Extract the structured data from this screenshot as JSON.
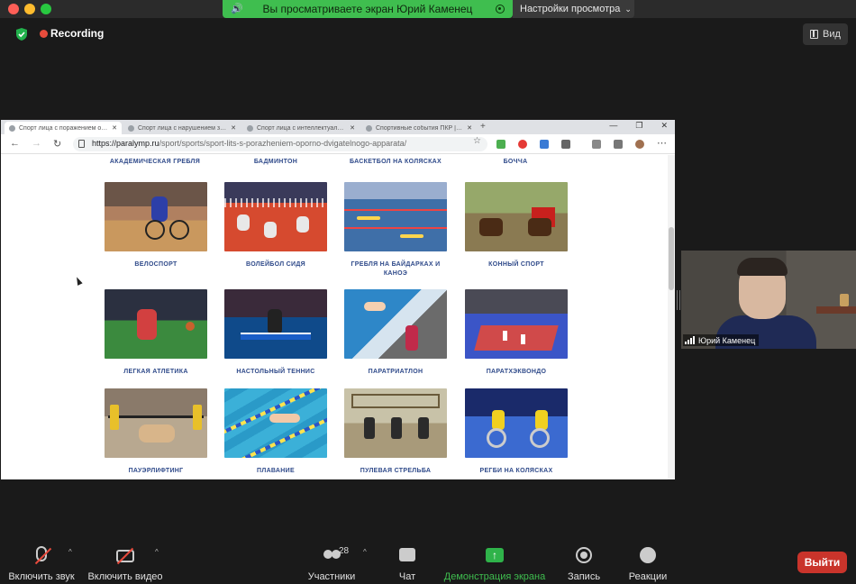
{
  "title_bar": {
    "share_banner": "Вы просматриваете экран Юрий Каменец",
    "view_settings": "Настройки просмотра"
  },
  "recording": {
    "label": "Recording"
  },
  "view_button": {
    "label": "Вид"
  },
  "browser": {
    "tabs": [
      {
        "label": "Спорт лица с поражением опорно-"
      },
      {
        "label": "Спорт лица с нарушением зрения"
      },
      {
        "label": "Спорт лица с интеллектуальными"
      },
      {
        "label": "Спортивные события ПКР | Па"
      }
    ],
    "new_tab": "+",
    "url_host": "https://paralymp.ru",
    "url_path": "/sport/sports/sport-lits-s-porazheniem-oporno-dvigatelnogo-apparata/",
    "top_labels": [
      "АКАДЕМИЧЕСКАЯ ГРЕБЛЯ",
      "БАДМИНТОН",
      "БАСКЕТБОЛ НА КОЛЯСКАХ",
      "БОЧЧА"
    ],
    "sports": [
      {
        "name": "ВЕЛОСПОРТ"
      },
      {
        "name": "ВОЛЕЙБОЛ СИДЯ"
      },
      {
        "name": "ГРЕБЛЯ НА БАЙДАРКАХ И КАНОЭ"
      },
      {
        "name": "КОННЫЙ СПОРТ"
      },
      {
        "name": "ЛЕГКАЯ АТЛЕТИКА"
      },
      {
        "name": "НАСТОЛЬНЫЙ ТЕННИС"
      },
      {
        "name": "ПАРАТРИАТЛОН"
      },
      {
        "name": "ПАРАТХЭКВОНДО"
      },
      {
        "name": "ПАУЭРЛИФТИНГ"
      },
      {
        "name": "ПЛАВАНИЕ"
      },
      {
        "name": "ПУЛЕВАЯ СТРЕЛЬБА"
      },
      {
        "name": "РЕГБИ НА КОЛЯСКАХ"
      }
    ]
  },
  "participant": {
    "name": "Юрий Каменец"
  },
  "toolbar": {
    "unmute": "Включить звук",
    "start_video": "Включить видео",
    "participants": "Участники",
    "participants_count": "28",
    "chat": "Чат",
    "share": "Демонстрация экрана",
    "record": "Запись",
    "reactions": "Реакции",
    "leave": "Выйти"
  },
  "colors": {
    "share_green": "#3fbe4f",
    "leave_red": "#c9342b",
    "recording_red": "#e74c3c",
    "sport_label_blue": "#2f4a8a"
  },
  "icons": [
    "shield-icon",
    "recording-dot-icon",
    "speaker-icon",
    "stop-share-icon",
    "view-icon",
    "mic-off-icon",
    "video-off-icon",
    "participants-icon",
    "chat-icon",
    "share-screen-icon",
    "record-icon",
    "reactions-icon"
  ]
}
